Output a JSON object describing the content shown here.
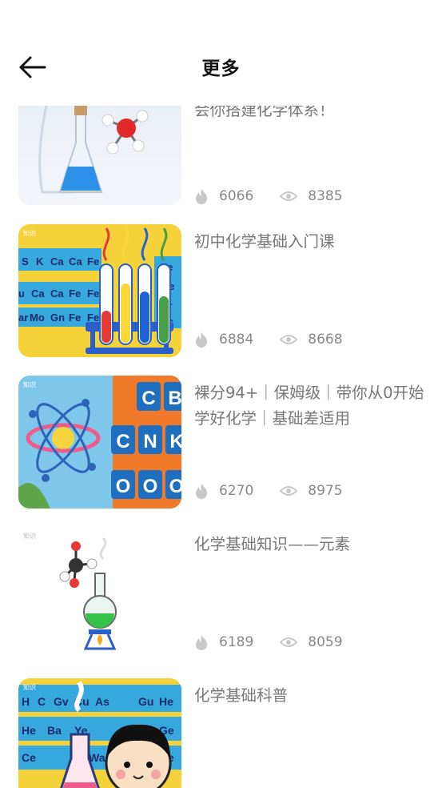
{
  "header": {
    "title": "更多"
  },
  "items": [
    {
      "title": "会你搭建化学体系！",
      "hot": "6066",
      "views": "8385"
    },
    {
      "title": "初中化学基础入门课",
      "hot": "6884",
      "views": "8668"
    },
    {
      "title": "裸分94+｜保姆级｜带你从0开始学好化学｜基础差适用",
      "hot": "6270",
      "views": "8975"
    },
    {
      "title": "化学基础知识——元素",
      "hot": "6189",
      "views": "8059"
    },
    {
      "title": "化学基础科普",
      "hot": "",
      "views": ""
    }
  ],
  "thumb_text": {
    "t2_row1": [
      "S",
      "K",
      "Ca",
      "Ca",
      "Fe"
    ],
    "t2_row2": [
      "u",
      "Ca",
      "Ca",
      "Fe",
      "Fe"
    ],
    "t2_row3": [
      "ar",
      "Mo",
      "Gn",
      "Fe",
      "Fe"
    ],
    "t2_right": [
      "Fe",
      "Ge",
      "Br",
      "Pc"
    ],
    "t3_tiles": [
      "C",
      "B",
      "C",
      "N",
      "K",
      "O",
      "O",
      "O"
    ],
    "t5_row1": [
      "H",
      "C",
      "Gv",
      "Cu",
      "As",
      "Gu",
      "He"
    ],
    "t5_row2": [
      "He",
      "Ba",
      "Ye",
      "Cu",
      "Ge"
    ],
    "t5_row3": [
      "Ce",
      "Wa",
      "Te",
      "Ge"
    ],
    "watermark": "知识"
  },
  "colors": {
    "accent": "#111111",
    "muted": "#777777",
    "icon": "#c8c8c8"
  }
}
